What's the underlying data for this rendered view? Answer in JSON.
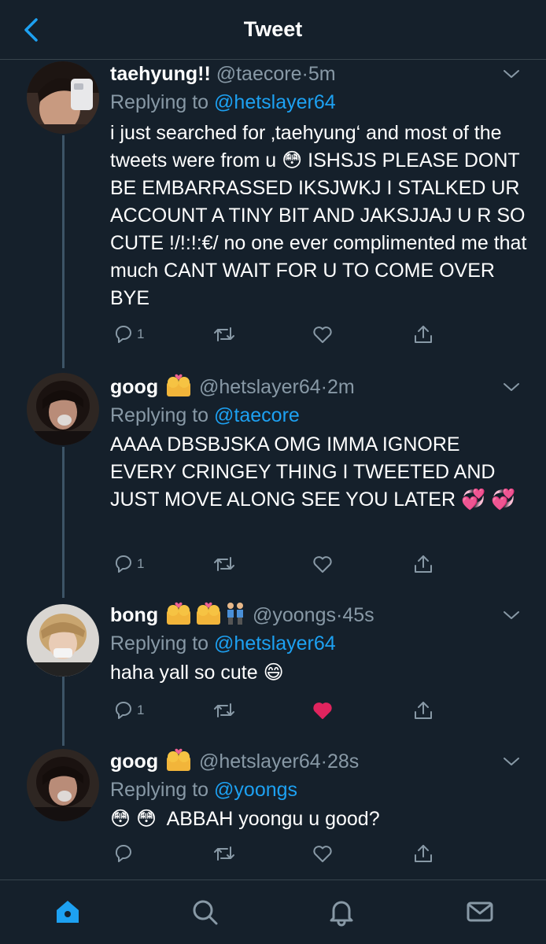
{
  "header": {
    "title": "Tweet"
  },
  "colors": {
    "accent": "#1da1f2",
    "background": "#15202b",
    "muted": "#8899a6",
    "like_active": "#e0245e"
  },
  "tweets": [
    {
      "name": "taehyung!!",
      "name_emojis": [],
      "handle": "@taecore",
      "dot": "·",
      "time": "5m",
      "replying_prefix": "Replying to ",
      "replying_to": "@hetslayer64",
      "text": "i just searched for ‚taehyung‘ and most of the tweets were from u 😳 ISHSJS PLEASE DONT BE EMBARRASSED IKSJWKJ I STALKED UR ACCOUNT A TINY BIT AND JAKSJJAJ U R SO CUTE !/!:!:€/ no one ever complimented me that much CANT WAIT FOR U TO COME OVER BYE",
      "reply_count": "1",
      "liked": false
    },
    {
      "name": "goog",
      "name_emojis": [
        "couple-kiss"
      ],
      "handle": "@hetslayer64",
      "dot": "·",
      "time": "2m",
      "replying_prefix": "Replying to ",
      "replying_to": "@taecore",
      "text": "AAAA DBSBJSKA OMG IMMA IGNORE EVERY CRINGEY THING I TWEETED AND JUST MOVE ALONG SEE YOU LATER 💞 💞",
      "reply_count": "1",
      "liked": false
    },
    {
      "name": "bong",
      "name_emojis": [
        "couple-kiss",
        "couple-kiss-2",
        "men-holding-hands"
      ],
      "handle": "@yoongs",
      "dot": "·",
      "time": "45s",
      "replying_prefix": "Replying to ",
      "replying_to": "@hetslayer64",
      "text": "haha yall so cute 😄",
      "reply_count": "1",
      "liked": true
    },
    {
      "name": "goog",
      "name_emojis": [
        "couple-kiss"
      ],
      "handle": "@hetslayer64",
      "dot": "·",
      "time": "28s",
      "replying_prefix": "Replying to ",
      "replying_to": "@yoongs",
      "text": "😳 😳  ABBAH yoongu u good?",
      "reply_count": "",
      "liked": false
    }
  ],
  "bottom_nav": [
    "home-icon",
    "search-icon",
    "notifications-icon",
    "messages-icon"
  ]
}
